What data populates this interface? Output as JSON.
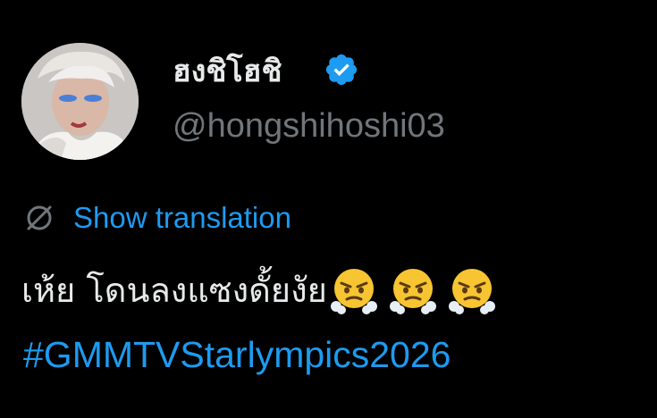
{
  "tweet": {
    "author": {
      "display_name": "ฮงชิโฮชิ",
      "handle": "@hongshihoshi03",
      "verified": true,
      "verified_icon": "verified-badge-icon",
      "avatar": "profile-avatar"
    },
    "translation": {
      "icon": "translate-globe-icon",
      "label": "Show translation"
    },
    "body": {
      "text": "เห้ย โดนลงแซงดั้ยงัย",
      "emojis": [
        "face-with-steam-from-nose-emoji",
        "face-with-steam-from-nose-emoji",
        "face-with-steam-from-nose-emoji"
      ]
    },
    "hashtag": "#GMMTVStarlympics2026"
  },
  "colors": {
    "background": "#000000",
    "primary_text": "#e7e9ea",
    "secondary_text": "#71767b",
    "accent": "#1d9bf0"
  }
}
